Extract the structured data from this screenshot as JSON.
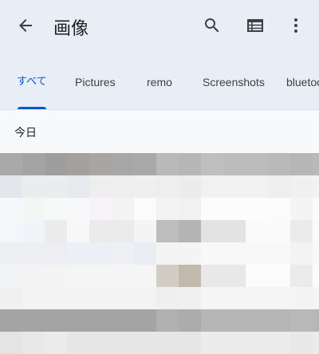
{
  "header": {
    "title": "画像",
    "back_icon": "arrow-back-icon",
    "search_icon": "search-icon",
    "view_icon": "list-view-icon",
    "more_icon": "more-vert-icon"
  },
  "tabs": [
    {
      "label": "すべて",
      "selected": true
    },
    {
      "label": "Pictures",
      "selected": false
    },
    {
      "label": "remo",
      "selected": false
    },
    {
      "label": "Screenshots",
      "selected": false
    },
    {
      "label": "bluetooth",
      "selected": false
    }
  ],
  "sections": [
    {
      "header": "今日"
    }
  ],
  "colors": {
    "accent": "#0b57d0",
    "appbar_bg": "#e8eef5",
    "page_bg": "#f8f9fb"
  }
}
